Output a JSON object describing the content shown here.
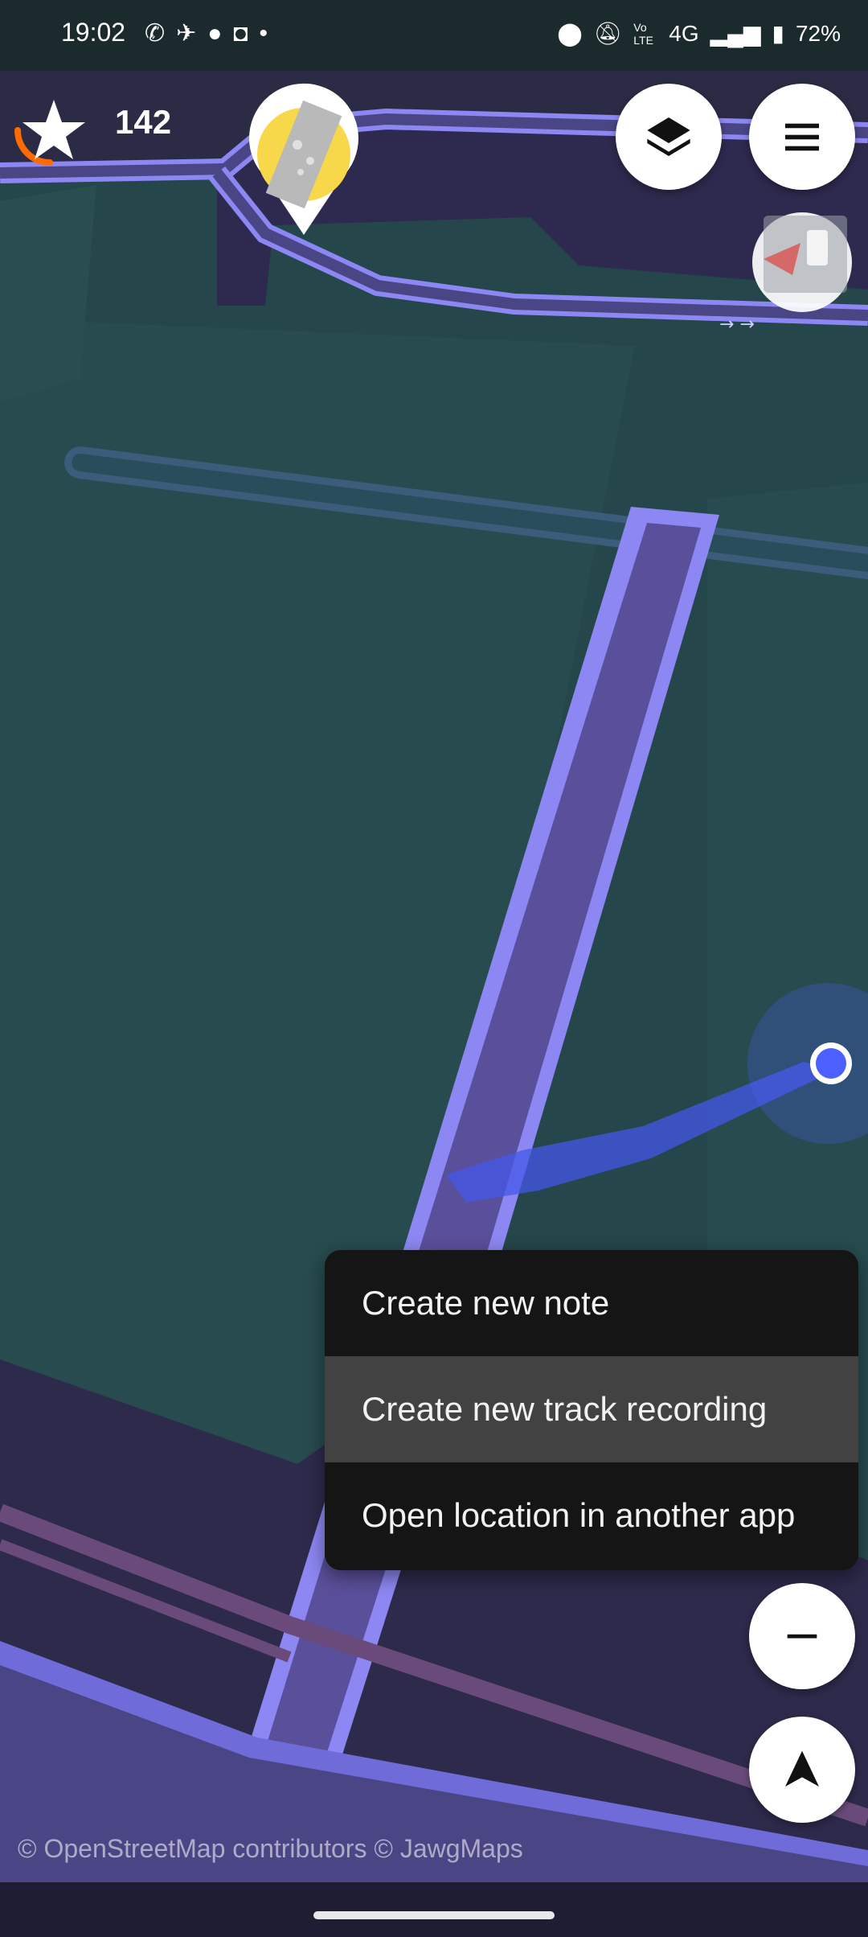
{
  "status_bar": {
    "time": "19:02",
    "notification_icons": [
      "whatsapp-icon",
      "telegram-icon",
      "chat-bubble-icon",
      "instagram-icon",
      "more-dot-icon"
    ],
    "system_icons": [
      "location-icon",
      "bell-off-icon",
      "volte-icon",
      "network-4g-icon",
      "signal-icon",
      "battery-charging-icon"
    ],
    "network_label": "4G",
    "volte_label": "Vo LTE",
    "battery_percent": "72%"
  },
  "map": {
    "star_count": "142",
    "star_progress_fraction": 0.3,
    "attribution": "© OpenStreetMap contributors   © JawgMaps"
  },
  "controls": {
    "layers_icon": "layers-icon",
    "menu_icon": "hamburger-menu-icon",
    "zoom_out_icon": "minus-icon",
    "locate_icon": "navigation-arrow-icon",
    "compass_icon": "compass-icon"
  },
  "context_menu": {
    "items": [
      {
        "label": "Create new note",
        "selected": false
      },
      {
        "label": "Create new track recording",
        "selected": true
      },
      {
        "label": "Open location in another app",
        "selected": false
      }
    ]
  },
  "colors": {
    "map_background": "#25464a",
    "road_fill": "#4a4585",
    "road_outline": "#8c87f2",
    "menu_background": "#151515",
    "menu_highlight": "#424242",
    "location_blue": "#4d5fff",
    "star_progress": "#ff6b00"
  }
}
